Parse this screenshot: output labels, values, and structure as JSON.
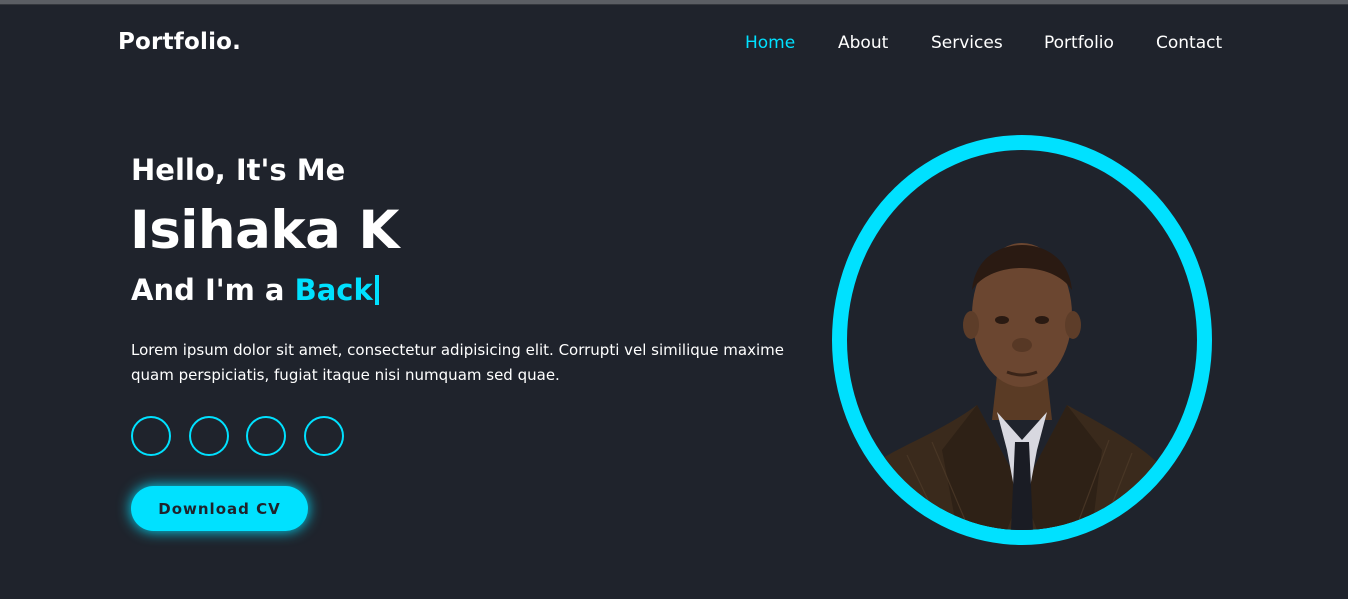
{
  "header": {
    "logo": "Portfolio.",
    "nav": [
      {
        "label": "Home",
        "active": true
      },
      {
        "label": "About",
        "active": false
      },
      {
        "label": "Services",
        "active": false
      },
      {
        "label": "Portfolio",
        "active": false
      },
      {
        "label": "Contact",
        "active": false
      }
    ]
  },
  "hero": {
    "greeting": "Hello, It's Me",
    "name": "Isihaka K",
    "role_prefix": "And I'm a ",
    "role_typed": "Back",
    "description": "Lorem ipsum dolor sit amet, consectetur adipisicing elit. Corrupti vel similique maxime quam perspiciatis, fugiat itaque nisi numquam sed quae.",
    "social_icons": [
      "social-link-1",
      "social-link-2",
      "social-link-3",
      "social-link-4"
    ],
    "cta_label": "Download CV"
  },
  "colors": {
    "background": "#1f232c",
    "accent": "#00e1ff",
    "text": "#ffffff"
  }
}
